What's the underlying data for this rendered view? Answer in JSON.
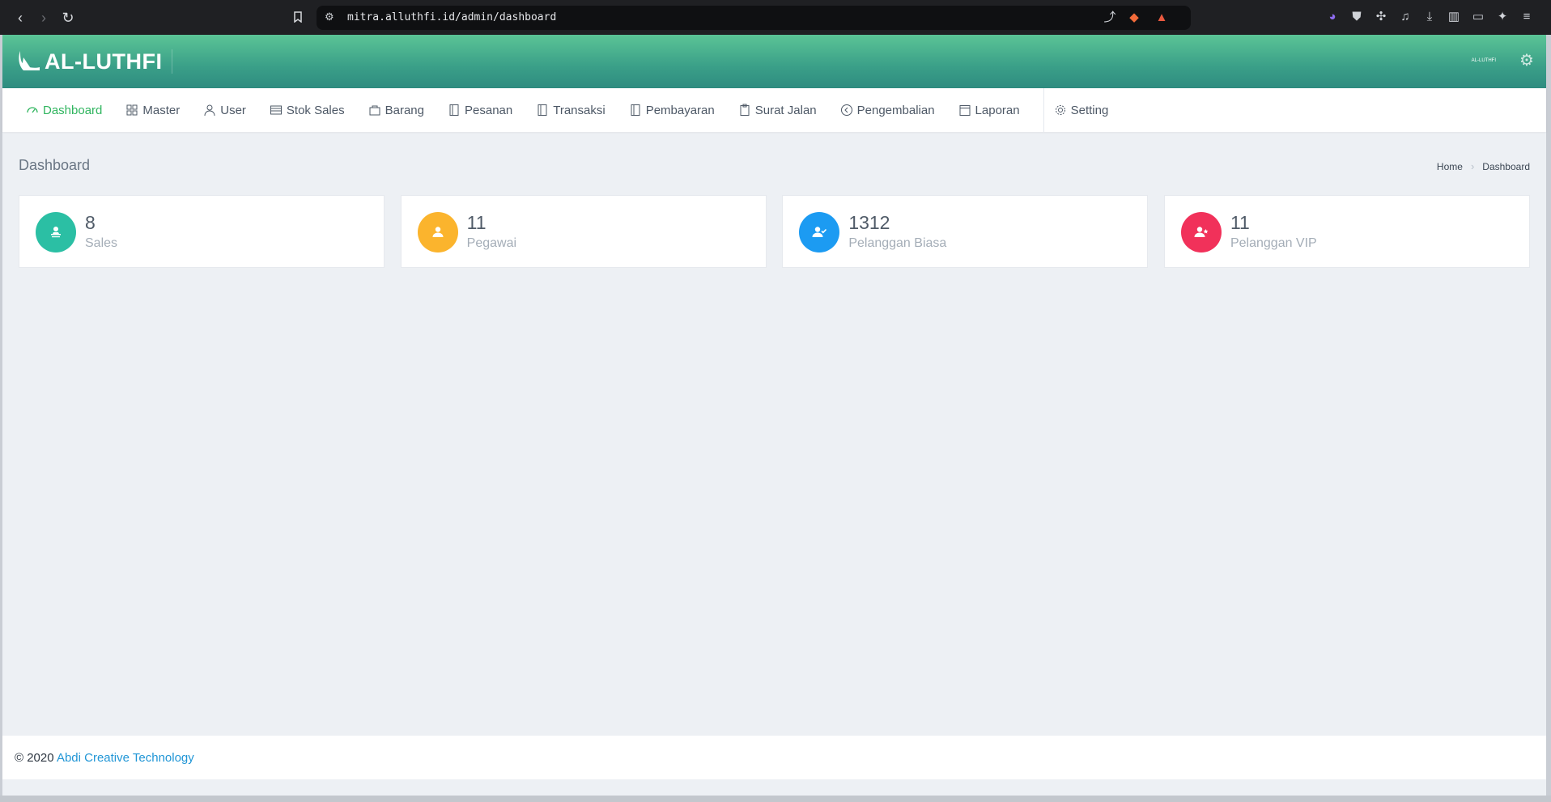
{
  "browser": {
    "url": "mitra.alluthfi.id/admin/dashboard",
    "notification_count": "1"
  },
  "app": {
    "logo_text": "AL-LUTHFI",
    "user_label": "AL-LUTHFI"
  },
  "menu": [
    {
      "label": "Dashboard",
      "icon": "dashboard-icon",
      "active": true
    },
    {
      "label": "Master",
      "icon": "grid-icon"
    },
    {
      "label": "User",
      "icon": "user-icon"
    },
    {
      "label": "Stok Sales",
      "icon": "stock-icon"
    },
    {
      "label": "Barang",
      "icon": "bag-icon"
    },
    {
      "label": "Pesanan",
      "icon": "document-icon"
    },
    {
      "label": "Transaksi",
      "icon": "document-icon"
    },
    {
      "label": "Pembayaran",
      "icon": "document-icon"
    },
    {
      "label": "Surat Jalan",
      "icon": "clipboard-icon"
    },
    {
      "label": "Pengembalian",
      "icon": "return-icon"
    },
    {
      "label": "Laporan",
      "icon": "calendar-icon"
    },
    {
      "label": "Setting",
      "icon": "gear-icon"
    }
  ],
  "page": {
    "title": "Dashboard",
    "breadcrumb": [
      "Home",
      "Dashboard"
    ]
  },
  "cards": [
    {
      "value": "8",
      "label": "Sales",
      "color": "#2bbfa4",
      "icon": "sales-person-icon"
    },
    {
      "value": "11",
      "label": "Pegawai",
      "color": "#fbb42d",
      "icon": "employee-icon"
    },
    {
      "value": "1312",
      "label": "Pelanggan Biasa",
      "color": "#1c9bf2",
      "icon": "user-check-icon"
    },
    {
      "value": "11",
      "label": "Pelanggan VIP",
      "color": "#f1315a",
      "icon": "user-star-icon"
    }
  ],
  "footer": {
    "copyright": "© 2020",
    "link_text": "Abdi Creative Technology"
  },
  "colors": {
    "accent_green": "#30b55f",
    "topbar_start": "#5bc496",
    "topbar_end": "#2f8c80",
    "link": "#2196d6"
  }
}
